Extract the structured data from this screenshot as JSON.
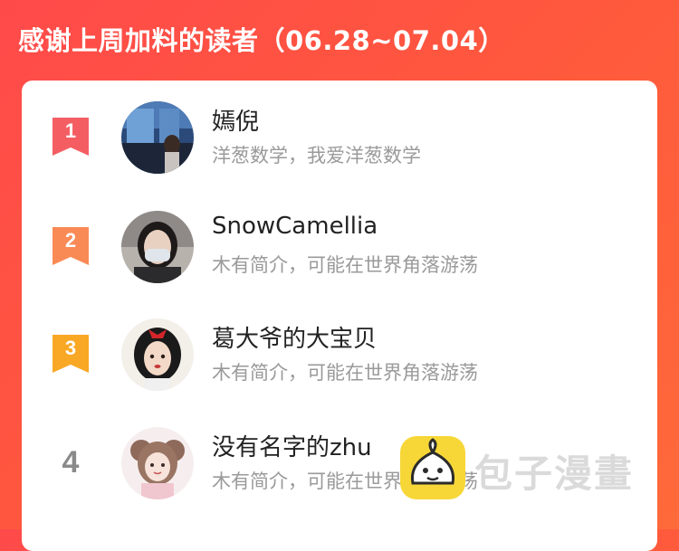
{
  "header": {
    "title": "感谢上周加料的读者（06.28~07.04）"
  },
  "readers": [
    {
      "rank": "1",
      "name": "嫣倪",
      "bio": "洋葱数学，我爱洋葱数学",
      "badge_color": "#f45e63",
      "avatar_icon": "avatar-window-night-photo"
    },
    {
      "rank": "2",
      "name": "SnowCamellia",
      "bio": "木有简介，可能在世界角落游荡",
      "badge_color": "#fa8a55",
      "avatar_icon": "avatar-masked-person-photo"
    },
    {
      "rank": "3",
      "name": "葛大爷的大宝贝",
      "bio": "木有简介，可能在世界角落游荡",
      "badge_color": "#f9a825",
      "avatar_icon": "avatar-cartoon-princess"
    },
    {
      "rank": "4",
      "name": "没有名字的zhu",
      "bio": "木有简介，可能在世界角落游荡",
      "avatar_icon": "avatar-anime-girl"
    }
  ],
  "watermark": {
    "text": "包子漫畫",
    "logo_icon": "baozi-logo-icon"
  },
  "colors": {
    "background": "#ff4f45",
    "card": "#ffffff",
    "name": "#222222",
    "bio": "#9a9a9a"
  }
}
